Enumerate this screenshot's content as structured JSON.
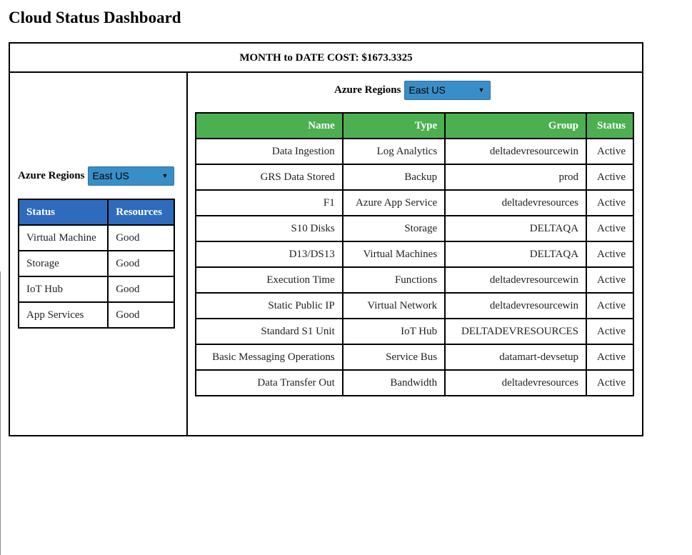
{
  "page": {
    "title": "Cloud Status Dashboard"
  },
  "cost": {
    "text": "MONTH to DATE COST: $1673.3325"
  },
  "left": {
    "region_label": "Azure Regions",
    "region_value": "East US",
    "table": {
      "headers": [
        "Status",
        "Resources"
      ],
      "rows": [
        [
          "Virtual Machine",
          "Good"
        ],
        [
          "Storage",
          "Good"
        ],
        [
          "IoT Hub",
          "Good"
        ],
        [
          "App Services",
          "Good"
        ]
      ]
    }
  },
  "right": {
    "region_label": "Azure Regions",
    "region_value": "East US",
    "table": {
      "headers": [
        "Name",
        "Type",
        "Group",
        "Status"
      ],
      "rows": [
        [
          "Data Ingestion",
          "Log Analytics",
          "deltadevresourcewin",
          "Active"
        ],
        [
          "GRS Data Stored",
          "Backup",
          "prod",
          "Active"
        ],
        [
          "F1",
          "Azure App Service",
          "deltadevresources",
          "Active"
        ],
        [
          "S10 Disks",
          "Storage",
          "DELTAQA",
          "Active"
        ],
        [
          "D13/DS13",
          "Virtual Machines",
          "DELTAQA",
          "Active"
        ],
        [
          "Execution Time",
          "Functions",
          "deltadevresourcewin",
          "Active"
        ],
        [
          "Static Public IP",
          "Virtual Network",
          "deltadevresourcewin",
          "Active"
        ],
        [
          "Standard S1 Unit",
          "IoT Hub",
          "DELTADEVRESOURCES",
          "Active"
        ],
        [
          "Basic Messaging Operations",
          "Service Bus",
          "datamart-devsetup",
          "Active"
        ],
        [
          "Data Transfer Out",
          "Bandwidth",
          "deltadevresources",
          "Active"
        ]
      ]
    }
  },
  "colors": {
    "status_header": "#2e6bbd",
    "resources_header": "#4caf50",
    "select_bg": "#3a8ec8"
  },
  "icons": {
    "select_caret": "caret-down-icon"
  }
}
